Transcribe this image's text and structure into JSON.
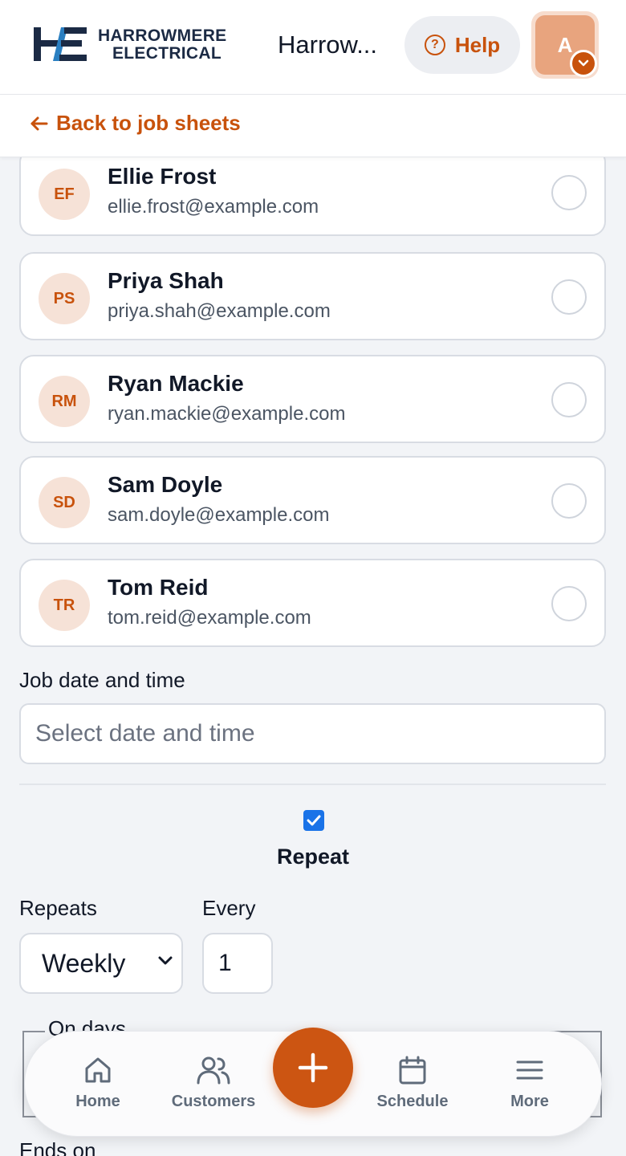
{
  "header": {
    "logo_line1": "HARROWMERE",
    "logo_line2": "ELECTRICAL",
    "app_title": "Harrow...",
    "help_label": "Help",
    "avatar_initial": "A"
  },
  "back_link": "Back to job sheets",
  "people": [
    {
      "initials": "EF",
      "name": "Ellie Frost",
      "email": "ellie.frost@example.com"
    },
    {
      "initials": "PS",
      "name": "Priya Shah",
      "email": "priya.shah@example.com"
    },
    {
      "initials": "RM",
      "name": "Ryan Mackie",
      "email": "ryan.mackie@example.com"
    },
    {
      "initials": "SD",
      "name": "Sam Doyle",
      "email": "sam.doyle@example.com"
    },
    {
      "initials": "TR",
      "name": "Tom Reid",
      "email": "tom.reid@example.com"
    }
  ],
  "job_date": {
    "label": "Job date and time",
    "placeholder": "Select date and time",
    "value": ""
  },
  "repeat": {
    "label": "Repeat",
    "checked": true,
    "repeats_label": "Repeats",
    "repeats_value": "Weekly",
    "every_label": "Every",
    "every_value": "1",
    "on_days_legend": "On days",
    "ends_on_label": "Ends on"
  },
  "nav": {
    "home": "Home",
    "customers": "Customers",
    "schedule": "Schedule",
    "more": "More"
  },
  "colors": {
    "accent": "#c8520c",
    "brand_dark": "#1b2a44",
    "checkbox": "#1a73e8"
  }
}
